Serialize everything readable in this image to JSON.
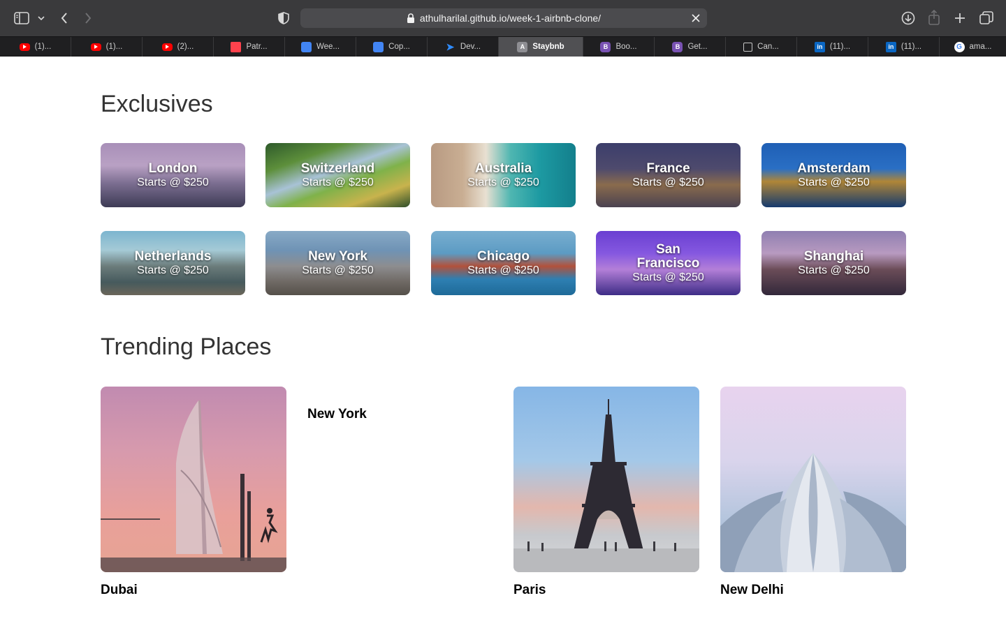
{
  "browser": {
    "url": "athulharilal.github.io/week-1-airbnb-clone/",
    "tabs": [
      {
        "label": "(1)...",
        "icon": "youtube-icon"
      },
      {
        "label": "(1)...",
        "icon": "youtube-icon"
      },
      {
        "label": "(2)...",
        "icon": "youtube-icon"
      },
      {
        "label": "Patr...",
        "icon": "patreon-icon"
      },
      {
        "label": "Wee...",
        "icon": "google-docs-icon"
      },
      {
        "label": "Cop...",
        "icon": "google-docs-icon"
      },
      {
        "label": "Dev...",
        "icon": "dev-icon"
      },
      {
        "label": "Staybnb",
        "icon": "a-letter-icon",
        "fav_text": "A",
        "active": true
      },
      {
        "label": "Boo...",
        "icon": "bootstrap-icon",
        "fav_text": "B"
      },
      {
        "label": "Get...",
        "icon": "bootstrap-icon",
        "fav_text": "B"
      },
      {
        "label": "Can...",
        "icon": "cube-icon"
      },
      {
        "label": "(11)...",
        "icon": "linkedin-icon",
        "fav_text": "in"
      },
      {
        "label": "(11)...",
        "icon": "linkedin-icon",
        "fav_text": "in"
      },
      {
        "label": "ama...",
        "icon": "google-icon",
        "fav_text": "G"
      }
    ]
  },
  "exclusives": {
    "title": "Exclusives",
    "cards": [
      {
        "city": "London",
        "price": "Starts @ $250"
      },
      {
        "city": "Switzerland",
        "price": "Starts @ $250"
      },
      {
        "city": "Australia",
        "price": "Starts @ $250"
      },
      {
        "city": "France",
        "price": "Starts @ $250"
      },
      {
        "city": "Amsterdam",
        "price": "Starts @ $250"
      },
      {
        "city": "Netherlands",
        "price": "Starts @ $250"
      },
      {
        "city": "New York",
        "price": "Starts @ $250"
      },
      {
        "city": "Chicago",
        "price": "Starts @ $250"
      },
      {
        "city": "San Francisco",
        "price": "Starts @ $250"
      },
      {
        "city": "Shanghai",
        "price": "Starts @ $250"
      }
    ]
  },
  "trending": {
    "title": "Trending Places",
    "places": [
      {
        "name": "Dubai"
      },
      {
        "name": "New York"
      },
      {
        "name": "Paris"
      },
      {
        "name": "New Delhi"
      }
    ]
  }
}
